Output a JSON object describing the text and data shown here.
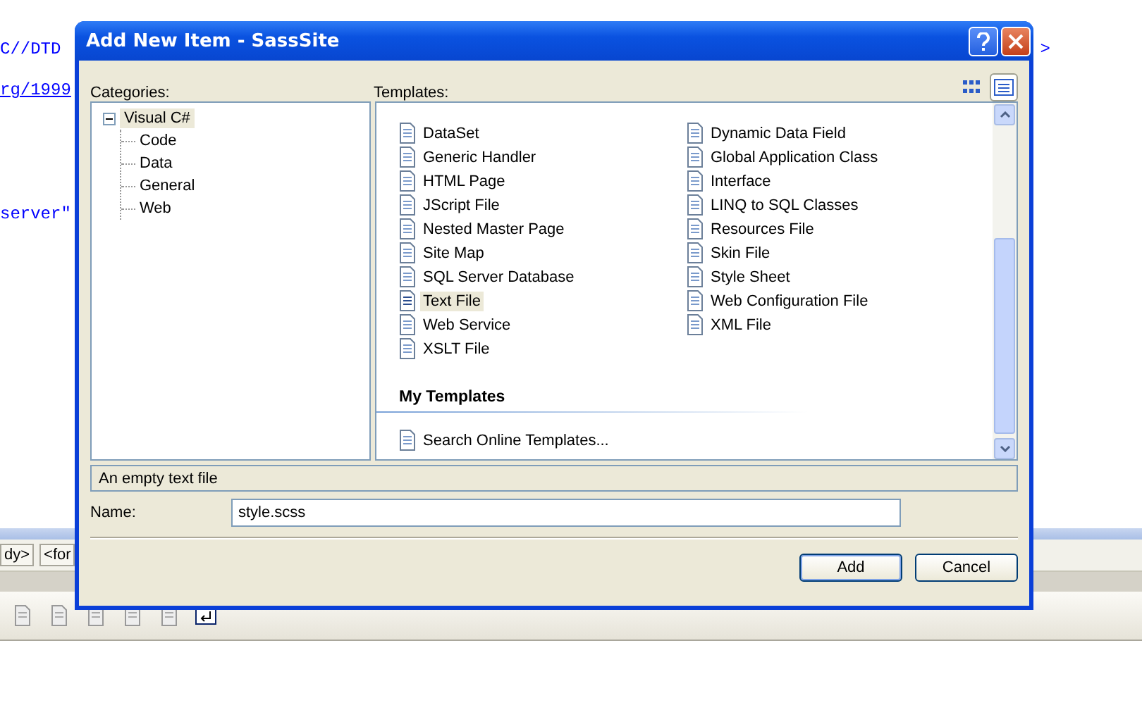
{
  "editor": {
    "lines": [
      {
        "left": "C//DTD",
        "right": ">",
        "link": false
      },
      {
        "left": "rg/1999",
        "link": true
      },
      {
        "left": "server\"",
        "link": false
      }
    ],
    "breadcrumbs": [
      "dy>",
      "<for"
    ]
  },
  "dialog": {
    "title": "Add New Item - SassSite",
    "categories": {
      "label": "Categories:",
      "tree": [
        {
          "label": "Visual C#",
          "expanded": true,
          "selected": true,
          "children": [
            {
              "label": "Code",
              "selected": false
            },
            {
              "label": "Data",
              "selected": false
            },
            {
              "label": "General",
              "selected": false
            },
            {
              "label": "Web",
              "selected": false
            }
          ]
        }
      ]
    },
    "templates": {
      "label": "Templates:",
      "view": [
        {
          "selected": false
        },
        {
          "selected": true
        }
      ],
      "columns": [
        [
          {
            "label": "DataSet",
            "selected": false
          },
          {
            "label": "Generic Handler",
            "selected": false
          },
          {
            "label": "HTML Page",
            "selected": false
          },
          {
            "label": "JScript File",
            "selected": false
          },
          {
            "label": "Nested Master Page",
            "selected": false
          },
          {
            "label": "Site Map",
            "selected": false
          },
          {
            "label": "SQL Server Database",
            "selected": false
          },
          {
            "label": "Text File",
            "selected": true
          },
          {
            "label": "Web Service",
            "selected": false
          },
          {
            "label": "XSLT File",
            "selected": false
          }
        ],
        [
          {
            "label": "Dynamic Data Field",
            "selected": false
          },
          {
            "label": "Global Application Class",
            "selected": false
          },
          {
            "label": "Interface",
            "selected": false
          },
          {
            "label": "LINQ to SQL Classes",
            "selected": false
          },
          {
            "label": "Resources File",
            "selected": false
          },
          {
            "label": "Skin File",
            "selected": false
          },
          {
            "label": "Style Sheet",
            "selected": false
          },
          {
            "label": "Web Configuration File",
            "selected": false
          },
          {
            "label": "XML File",
            "selected": false
          }
        ]
      ],
      "my_templates": {
        "heading": "My Templates",
        "items": [
          {
            "label": "Search Online Templates...",
            "selected": false
          }
        ]
      }
    },
    "description": "An empty text file",
    "name": {
      "label": "Name:",
      "value": "style.scss"
    },
    "buttons": [
      {
        "label": "Add",
        "default": true
      },
      {
        "label": "Cancel",
        "default": false
      }
    ]
  }
}
